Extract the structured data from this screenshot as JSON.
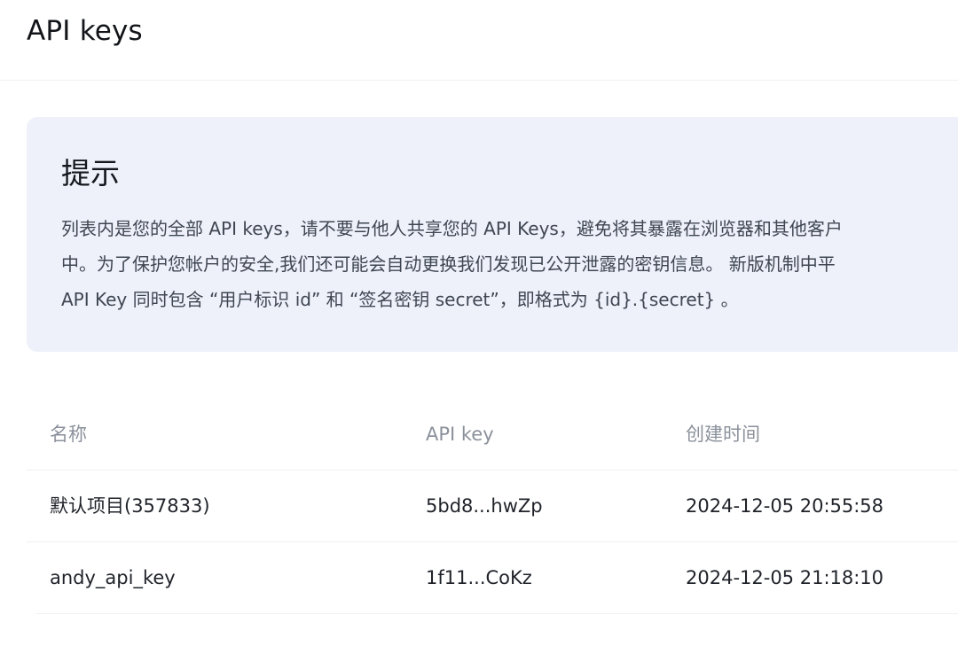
{
  "header": {
    "title": "API keys"
  },
  "notice": {
    "title": "提示",
    "lines": [
      "列表内是您的全部 API keys，请不要与他人共享您的 API Keys，避免将其暴露在浏览器和其他客户",
      "中。为了保护您帐户的安全,我们还可能会自动更换我们发现已公开泄露的密钥信息。 新版机制中平",
      "API Key 同时包含 “用户标识 id” 和 “签名密钥 secret”，即格式为 {id}.{secret} 。"
    ]
  },
  "table": {
    "columns": [
      "名称",
      "API key",
      "创建时间"
    ],
    "rows": [
      {
        "name": "默认项目(357833)",
        "api_key": "5bd8...hwZp",
        "created": "2024-12-05 20:55:58"
      },
      {
        "name": "andy_api_key",
        "api_key": "1f11...CoKz",
        "created": "2024-12-05 21:18:10"
      }
    ]
  }
}
